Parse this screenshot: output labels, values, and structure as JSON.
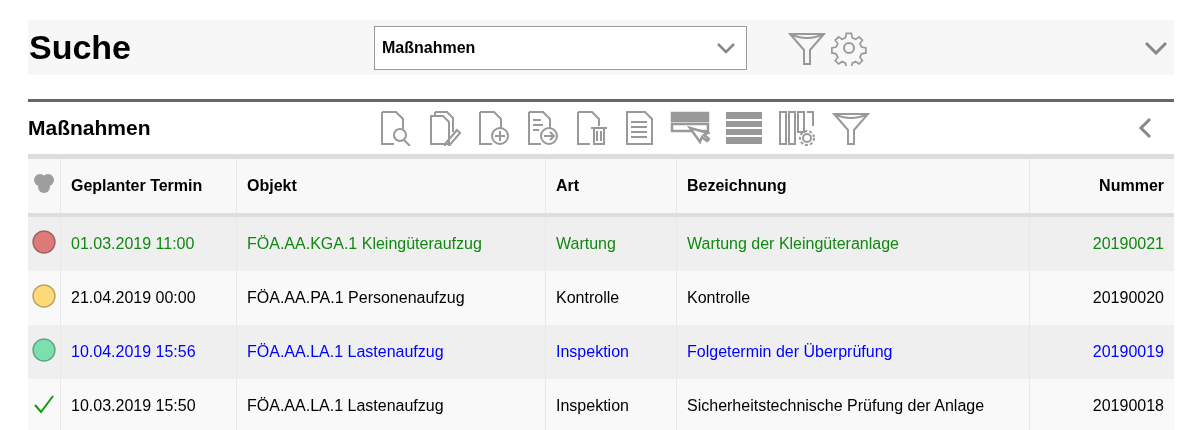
{
  "header": {
    "title": "Suche",
    "select": {
      "value": "Maßnahmen"
    }
  },
  "section": {
    "title": "Maßnahmen"
  },
  "table": {
    "columns": [
      {
        "label": "Geplanter Termin"
      },
      {
        "label": "Objekt"
      },
      {
        "label": "Art"
      },
      {
        "label": "Bezeichnung"
      },
      {
        "label": "Nummer"
      }
    ],
    "rows": [
      {
        "status": {
          "kind": "dot",
          "color": "#dd7b7b"
        },
        "color": "#118811",
        "cells": [
          "01.03.2019 11:00",
          "FÖA.AA.KGA.1 Kleingüteraufzug",
          "Wartung",
          "Wartung der Kleingüteranlage",
          "20190021"
        ]
      },
      {
        "status": {
          "kind": "dot",
          "color": "#ffd97a"
        },
        "color": "#000000",
        "cells": [
          "21.04.2019 00:00",
          "FÖA.AA.PA.1 Personenaufzug",
          "Kontrolle",
          "Kontrolle",
          "20190020"
        ]
      },
      {
        "status": {
          "kind": "dot",
          "color": "#7ddfae"
        },
        "color": "#0000ff",
        "cells": [
          "10.04.2019 15:56",
          "FÖA.AA.LA.1 Lastenaufzug",
          "Inspektion",
          "Folgetermin der Überprüfung",
          "20190019"
        ]
      },
      {
        "status": {
          "kind": "check",
          "color": "#119911"
        },
        "color": "#000000",
        "cells": [
          "10.03.2019 15:50",
          "FÖA.AA.LA.1 Lastenaufzug",
          "Inspektion",
          "Sicherheitstechnische Prüfung der Anlage",
          "20190018"
        ]
      }
    ]
  }
}
